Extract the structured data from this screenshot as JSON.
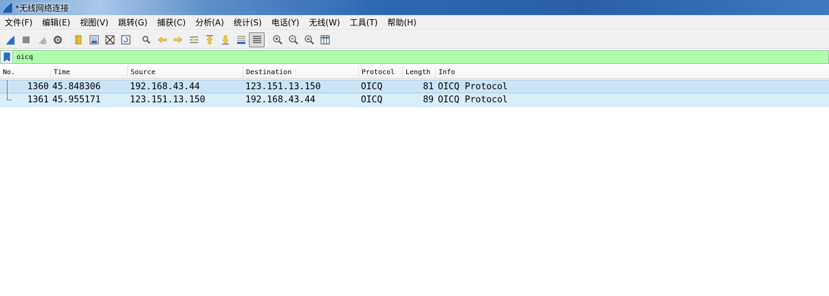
{
  "window": {
    "title": "*无线网络连接"
  },
  "menu": [
    "文件(F)",
    "编辑(E)",
    "视图(V)",
    "跳转(G)",
    "捕获(C)",
    "分析(A)",
    "统计(S)",
    "电话(Y)",
    "无线(W)",
    "工具(T)",
    "帮助(H)"
  ],
  "toolbar": {
    "buttons": [
      "start-capture-icon",
      "stop-capture-icon",
      "restart-capture-icon",
      "capture-options-icon",
      "open-file-icon",
      "save-file-icon",
      "close-file-icon",
      "reload-file-icon",
      "find-packet-icon",
      "go-back-icon",
      "go-forward-icon",
      "go-to-packet-icon",
      "go-first-icon",
      "go-last-icon",
      "auto-scroll-icon",
      "colorize-icon",
      "zoom-in-icon",
      "zoom-out-icon",
      "zoom-normal-icon",
      "resize-columns-icon"
    ]
  },
  "filter": {
    "value": "oicq"
  },
  "columns": [
    "No.",
    "Time",
    "Source",
    "Destination",
    "Protocol",
    "Length",
    "Info"
  ],
  "packets": [
    {
      "no": "1360",
      "time": "45.848306",
      "source": "192.168.43.44",
      "destination": "123.151.13.150",
      "protocol": "OICQ",
      "length": "81",
      "info": "OICQ Protocol"
    },
    {
      "no": "1361",
      "time": "45.955171",
      "source": "123.151.13.150",
      "destination": "192.168.43.44",
      "protocol": "OICQ",
      "length": "89",
      "info": "OICQ Protocol"
    }
  ],
  "colors": {
    "filter_valid": "#afffaf",
    "row_bg": "#daeefa",
    "row_selected": "#cce4f7"
  }
}
